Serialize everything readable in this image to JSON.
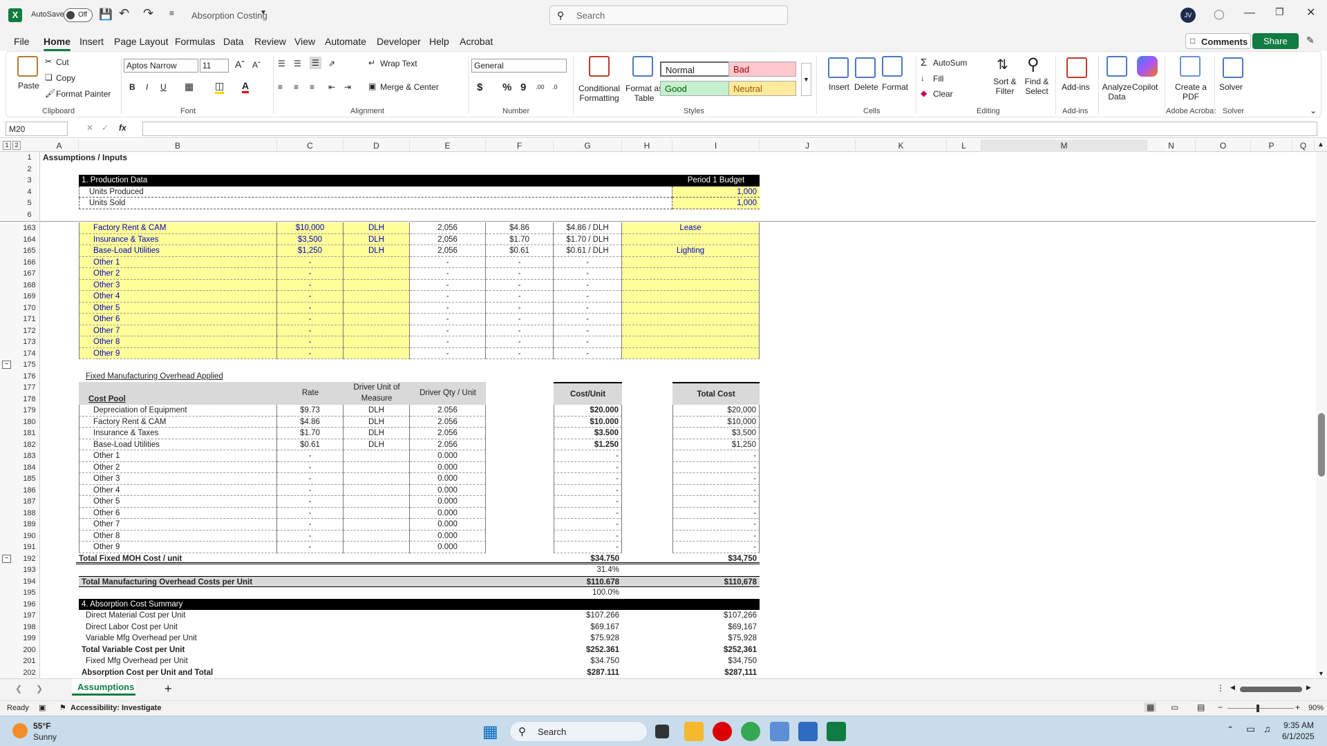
{
  "titlebar": {
    "autosave_label": "AutoSave",
    "autosave_state": "Off",
    "filename": "Absorption Costing",
    "search_placeholder": "Search",
    "user_initials": "JV"
  },
  "menu_tabs": [
    "File",
    "Home",
    "Insert",
    "Page Layout",
    "Formulas",
    "Data",
    "Review",
    "View",
    "Automate",
    "Developer",
    "Help",
    "Acrobat"
  ],
  "active_tab": "Home",
  "right_buttons": {
    "comments": "Comments",
    "share": "Share"
  },
  "ribbon": {
    "clipboard": {
      "paste": "Paste",
      "cut": "Cut",
      "copy": "Copy",
      "format_painter": "Format Painter",
      "label": "Clipboard"
    },
    "font": {
      "name": "Aptos Narrow",
      "size": "11",
      "label": "Font"
    },
    "alignment": {
      "wrap": "Wrap Text",
      "merge": "Merge & Center",
      "label": "Alignment"
    },
    "number": {
      "format": "General",
      "label": "Number"
    },
    "styles": {
      "conditional": "Conditional Formatting",
      "format_table": "Format as Table",
      "normal": "Normal",
      "bad": "Bad",
      "good": "Good",
      "neutral": "Neutral",
      "label": "Styles"
    },
    "cells": {
      "insert": "Insert",
      "delete": "Delete",
      "format": "Format",
      "label": "Cells"
    },
    "editing": {
      "autosum": "AutoSum",
      "fill": "Fill",
      "clear": "Clear",
      "sort": "Sort & Filter",
      "find": "Find & Select",
      "label": "Editing"
    },
    "addins": {
      "addins": "Add-ins",
      "label": "Add-ins"
    },
    "analyze": {
      "analyze": "Analyze Data",
      "copilot": "Copilot"
    },
    "acrobat": {
      "create": "Create a PDF",
      "label": "Adobe Acrobat"
    },
    "solver": {
      "solver": "Solver",
      "label": "Solver"
    }
  },
  "formula": {
    "namebox": "M20",
    "fx": "fx"
  },
  "columns": [
    "A",
    "B",
    "C",
    "D",
    "E",
    "F",
    "G",
    "H",
    "I",
    "J",
    "K",
    "L",
    "M",
    "N",
    "O",
    "P",
    "Q"
  ],
  "sheet": {
    "r1": "Assumptions / Inputs",
    "r3_a": "1. Production Data",
    "r3_i": "Period 1 Budget",
    "r4_a": "Units Produced",
    "r4_i": "1,000",
    "r5_a": "Units Sold",
    "r5_i": "1,000",
    "top_rows": [
      {
        "n": "163",
        "b": "Factory Rent & CAM",
        "c": "$10,000",
        "d": "DLH",
        "e": "2,056",
        "f": "$4.86",
        "g": "$4.86 / DLH",
        "h": "Lease"
      },
      {
        "n": "164",
        "b": "Insurance & Taxes",
        "c": "$3,500",
        "d": "DLH",
        "e": "2,056",
        "f": "$1.70",
        "g": "$1.70 / DLH",
        "h": ""
      },
      {
        "n": "165",
        "b": "Base-Load Utilities",
        "c": "$1,250",
        "d": "DLH",
        "e": "2,056",
        "f": "$0.61",
        "g": "$0.61 / DLH",
        "h": "Lighting"
      },
      {
        "n": "166",
        "b": "Other 1",
        "c": "-",
        "d": "",
        "e": "-",
        "f": "-",
        "g": "-",
        "h": ""
      },
      {
        "n": "167",
        "b": "Other 2",
        "c": "-",
        "d": "",
        "e": "-",
        "f": "-",
        "g": "-",
        "h": ""
      },
      {
        "n": "168",
        "b": "Other 3",
        "c": "-",
        "d": "",
        "e": "-",
        "f": "-",
        "g": "-",
        "h": ""
      },
      {
        "n": "169",
        "b": "Other 4",
        "c": "-",
        "d": "",
        "e": "-",
        "f": "-",
        "g": "-",
        "h": ""
      },
      {
        "n": "170",
        "b": "Other 5",
        "c": "-",
        "d": "",
        "e": "-",
        "f": "-",
        "g": "-",
        "h": ""
      },
      {
        "n": "171",
        "b": "Other 6",
        "c": "-",
        "d": "",
        "e": "-",
        "f": "-",
        "g": "-",
        "h": ""
      },
      {
        "n": "172",
        "b": "Other 7",
        "c": "-",
        "d": "",
        "e": "-",
        "f": "-",
        "g": "-",
        "h": ""
      },
      {
        "n": "173",
        "b": "Other 8",
        "c": "-",
        "d": "",
        "e": "-",
        "f": "-",
        "g": "-",
        "h": ""
      },
      {
        "n": "174",
        "b": "Other 9",
        "c": "-",
        "d": "",
        "e": "-",
        "f": "-",
        "g": "-",
        "h": ""
      }
    ],
    "r176": "Fixed Manufacturing Overhead Applied",
    "hdr_cost_pool": "Cost Pool",
    "hdr_rate": "Rate",
    "hdr_driver": "Driver Unit of Measure",
    "hdr_qty": "Driver Qty / Unit",
    "hdr_cost_unit": "Cost/Unit",
    "hdr_total": "Total Cost",
    "fixed_rows": [
      {
        "n": "179",
        "b": "Depreciation of Equipment",
        "c": "$9.73",
        "d": "DLH",
        "e": "2.056",
        "g": "$20.000",
        "i": "$20,000"
      },
      {
        "n": "180",
        "b": "Factory Rent & CAM",
        "c": "$4.86",
        "d": "DLH",
        "e": "2.056",
        "g": "$10.000",
        "i": "$10,000"
      },
      {
        "n": "181",
        "b": "Insurance & Taxes",
        "c": "$1.70",
        "d": "DLH",
        "e": "2.056",
        "g": "$3.500",
        "i": "$3,500"
      },
      {
        "n": "182",
        "b": "Base-Load Utilities",
        "c": "$0.61",
        "d": "DLH",
        "e": "2.056",
        "g": "$1.250",
        "i": "$1,250"
      },
      {
        "n": "183",
        "b": "Other 1",
        "c": "-",
        "d": "",
        "e": "0.000",
        "g": "-",
        "i": "-"
      },
      {
        "n": "184",
        "b": "Other 2",
        "c": "-",
        "d": "",
        "e": "0.000",
        "g": "-",
        "i": "-"
      },
      {
        "n": "185",
        "b": "Other 3",
        "c": "-",
        "d": "",
        "e": "0.000",
        "g": "-",
        "i": "-"
      },
      {
        "n": "186",
        "b": "Other 4",
        "c": "-",
        "d": "",
        "e": "0.000",
        "g": "-",
        "i": "-"
      },
      {
        "n": "187",
        "b": "Other 5",
        "c": "-",
        "d": "",
        "e": "0.000",
        "g": "-",
        "i": "-"
      },
      {
        "n": "188",
        "b": "Other 6",
        "c": "-",
        "d": "",
        "e": "0.000",
        "g": "-",
        "i": "-"
      },
      {
        "n": "189",
        "b": "Other 7",
        "c": "-",
        "d": "",
        "e": "0.000",
        "g": "-",
        "i": "-"
      },
      {
        "n": "190",
        "b": "Other 8",
        "c": "-",
        "d": "",
        "e": "0.000",
        "g": "-",
        "i": "-"
      },
      {
        "n": "191",
        "b": "Other 9",
        "c": "-",
        "d": "",
        "e": "0.000",
        "g": "-",
        "i": "-"
      }
    ],
    "r192_a": "Total Fixed MOH Cost / unit",
    "r192_g": "$34.750",
    "r192_i": "$34,750",
    "r193_g": "31.4%",
    "r194_a": "Total Manufacturing Overhead Costs per Unit",
    "r194_g": "$110.678",
    "r194_i": "$110,678",
    "r195_g": "100.0%",
    "r196_a": "4. Absorption Cost Summary",
    "summary": [
      {
        "n": "197",
        "a": "Direct Material Cost per Unit",
        "g": "$107.266",
        "i": "$107,266",
        "bold": false
      },
      {
        "n": "198",
        "a": "Direct Labor Cost per Unit",
        "g": "$69.167",
        "i": "$69,167",
        "bold": false
      },
      {
        "n": "199",
        "a": "Variable Mfg Overhead per Unit",
        "g": "$75.928",
        "i": "$75,928",
        "bold": false
      },
      {
        "n": "200",
        "a": "Total Variable Cost per Unit",
        "g": "$252.361",
        "i": "$252,361",
        "bold": true
      },
      {
        "n": "201",
        "a": "Fixed Mfg Overhead per Unit",
        "g": "$34.750",
        "i": "$34,750",
        "bold": false
      },
      {
        "n": "202",
        "a": "Absorption Cost per Unit and Total",
        "g": "$287.111",
        "i": "$287,111",
        "bold": true
      }
    ]
  },
  "sheet_tab": "Assumptions",
  "status": {
    "ready": "Ready",
    "accessibility": "Accessibility: Investigate",
    "zoom": "90%"
  },
  "taskbar": {
    "temp": "55°F",
    "weather": "Sunny",
    "search": "Search",
    "time": "9:35 AM",
    "date": "6/1/2025"
  }
}
